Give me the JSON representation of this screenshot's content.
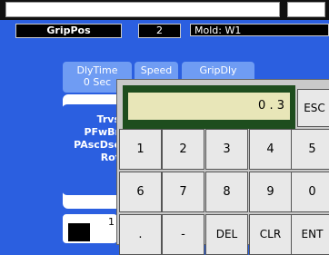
{
  "header": {
    "left_field": "",
    "right_field": ""
  },
  "status": {
    "title": "GripPos",
    "index": "2",
    "mold": "Mold: W1"
  },
  "tabs": [
    {
      "label": "DlyTime",
      "value": "0 Sec"
    },
    {
      "label": "Speed",
      "value": ""
    },
    {
      "label": "GripDly",
      "value": ""
    }
  ],
  "panel": {
    "rows": [
      "Trvs",
      "PFwBr",
      "PAscDsc",
      "Rot"
    ]
  },
  "bottom": {
    "label": "1"
  },
  "keypad": {
    "display": "0 . 3",
    "esc": "ESC",
    "keys_row1": [
      "1",
      "2",
      "3",
      "4",
      "5"
    ],
    "keys_row2": [
      "6",
      "7",
      "8",
      "9",
      "0"
    ],
    "keys_row3": [
      ".",
      "-",
      "DEL",
      "CLR",
      "ENT"
    ]
  }
}
